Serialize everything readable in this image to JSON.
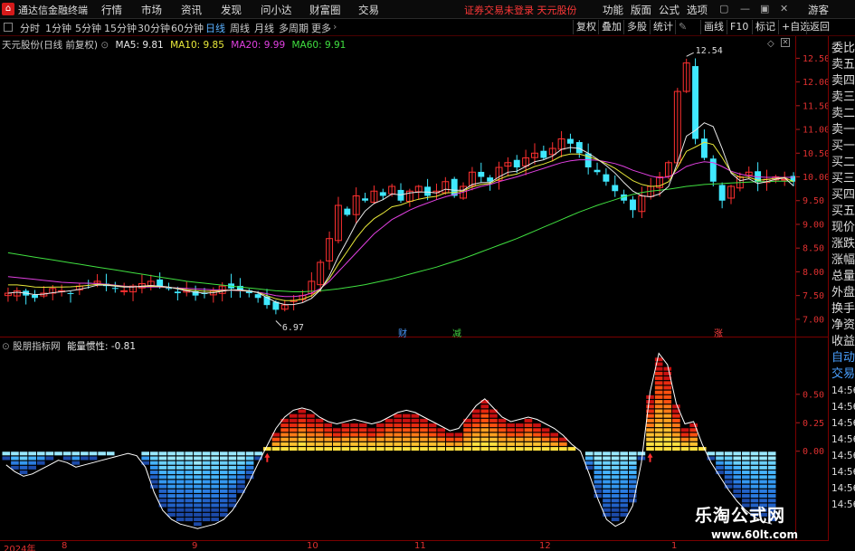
{
  "menubar": {
    "app_name": "通达信金融终端",
    "menus": [
      "行情",
      "市场",
      "资讯",
      "发现",
      "问小达",
      "财富圈",
      "交易"
    ],
    "warning": "证券交易未登录  天元股份",
    "right_menus": [
      "功能",
      "版面",
      "公式",
      "选项"
    ],
    "user": "游客"
  },
  "periodbar": {
    "periods": [
      "分时",
      "1分钟",
      "5分钟",
      "15分钟",
      "30分钟",
      "60分钟",
      "日线",
      "周线",
      "月线",
      "多周期",
      "更多"
    ],
    "active": "日线",
    "right_buttons": [
      "复权",
      "叠加",
      "多股",
      "统计",
      "画线",
      "F10",
      "标记",
      "+自选",
      "返回"
    ]
  },
  "legend": {
    "title": "天元股份(日线 前复权)",
    "ma": [
      {
        "label": "MA5: 9.81",
        "color": "#e8e8e8"
      },
      {
        "label": "MA10: 9.85",
        "color": "#e8e83a"
      },
      {
        "label": "MA20: 9.99",
        "color": "#e040e0"
      },
      {
        "label": "MA60: 9.91",
        "color": "#40e040"
      }
    ]
  },
  "indicator_legend": {
    "name": "股朋指标网",
    "series": "能量惯性: -0.81"
  },
  "price_axis": {
    "labels": [
      "12.50",
      "12.00",
      "11.50",
      "11.00",
      "10.50",
      "10.00",
      "9.50",
      "9.00",
      "8.50",
      "8.00",
      "7.50",
      "7.00"
    ],
    "min": 6.75,
    "max": 12.85
  },
  "indicator_axis": {
    "labels": [
      "0.50",
      "0.25",
      "0.00"
    ],
    "min": -0.75,
    "max": 0.92
  },
  "annotations": {
    "high": "12.54",
    "low": "6.97",
    "markers": [
      {
        "text": "财",
        "color": "#4a9aff"
      },
      {
        "text": "减",
        "color": "#40d040"
      },
      {
        "text": "涨",
        "color": "#ff4040"
      }
    ]
  },
  "sidepanel": {
    "items": [
      "委比",
      "卖五",
      "卖四",
      "卖三",
      "卖二",
      "卖一",
      "买一",
      "买二",
      "买三",
      "买四",
      "买五",
      "现价",
      "涨跌",
      "涨幅",
      "总量",
      "外盘",
      "换手",
      "净资",
      "收益",
      "自动",
      "交易",
      "14:56",
      "14:56",
      "14:56",
      "14:56",
      "14:56",
      "14:56",
      "14:56",
      "14:56"
    ],
    "blue_items": [
      "自动",
      "交易"
    ]
  },
  "dateaxis": {
    "labels": [
      "2024年",
      "8",
      "9",
      "10",
      "11",
      "12",
      "1"
    ]
  },
  "watermark": {
    "line1": "乐淘公式网",
    "line2": "www.60lt.com"
  },
  "chart_data": [
    {
      "type": "candlestick",
      "title": "天元股份(日线 前复权)",
      "ylim": [
        6.75,
        12.85
      ],
      "series_names": [
        "MA5",
        "MA10",
        "MA20",
        "MA60"
      ],
      "annotations": {
        "high": 12.54,
        "low": 6.97
      },
      "close_path": [
        7.55,
        7.6,
        7.5,
        7.45,
        7.55,
        7.65,
        7.6,
        7.55,
        7.7,
        7.75,
        7.8,
        7.7,
        7.65,
        7.6,
        7.7,
        7.75,
        7.8,
        7.7,
        7.65,
        7.55,
        7.6,
        7.5,
        7.55,
        7.6,
        7.7,
        7.65,
        7.6,
        7.55,
        7.45,
        7.3,
        7.2,
        7.3,
        7.4,
        7.5,
        7.8,
        8.2,
        8.7,
        9.4,
        9.2,
        9.6,
        9.5,
        9.7,
        9.6,
        9.8,
        9.5,
        9.7,
        9.8,
        9.6,
        9.7,
        9.9,
        9.6,
        9.8,
        10.1,
        10.0,
        9.9,
        10.2,
        10.3,
        10.2,
        10.4,
        10.5,
        10.4,
        10.6,
        10.8,
        10.7,
        10.5,
        10.2,
        10.1,
        9.9,
        9.7,
        9.5,
        9.3,
        9.6,
        9.8,
        10.0,
        10.3,
        11.8,
        12.4,
        10.8,
        10.4,
        9.9,
        9.5,
        9.8,
        10.0,
        10.1,
        9.9,
        9.95,
        10.0,
        9.95,
        9.9
      ],
      "ma5": [
        7.55,
        7.57,
        7.55,
        7.52,
        7.53,
        7.56,
        7.58,
        7.6,
        7.63,
        7.67,
        7.72,
        7.72,
        7.7,
        7.68,
        7.68,
        7.7,
        7.71,
        7.7,
        7.68,
        7.64,
        7.6,
        7.57,
        7.55,
        7.56,
        7.59,
        7.62,
        7.62,
        7.6,
        7.56,
        7.46,
        7.36,
        7.31,
        7.31,
        7.35,
        7.44,
        7.62,
        7.92,
        8.32,
        8.66,
        9.02,
        9.28,
        9.44,
        9.52,
        9.64,
        9.62,
        9.66,
        9.68,
        9.68,
        9.66,
        9.74,
        9.72,
        9.72,
        9.84,
        9.88,
        9.88,
        10.0,
        10.1,
        10.12,
        10.22,
        10.32,
        10.36,
        10.44,
        10.58,
        10.62,
        10.6,
        10.5,
        10.38,
        10.24,
        10.08,
        9.88,
        9.7,
        9.6,
        9.58,
        9.64,
        9.8,
        10.3,
        10.86,
        10.98,
        11.14,
        11.06,
        10.6,
        10.08,
        9.92,
        9.96,
        9.86,
        9.9,
        9.95,
        9.98,
        9.81
      ],
      "ma20": [
        7.9,
        7.88,
        7.86,
        7.84,
        7.82,
        7.8,
        7.78,
        7.77,
        7.76,
        7.76,
        7.75,
        7.74,
        7.72,
        7.7,
        7.69,
        7.68,
        7.68,
        7.68,
        7.67,
        7.66,
        7.65,
        7.64,
        7.63,
        7.62,
        7.62,
        7.61,
        7.6,
        7.59,
        7.57,
        7.54,
        7.5,
        7.48,
        7.48,
        7.5,
        7.55,
        7.65,
        7.8,
        8.0,
        8.2,
        8.4,
        8.6,
        8.8,
        8.95,
        9.1,
        9.2,
        9.3,
        9.38,
        9.45,
        9.52,
        9.58,
        9.63,
        9.68,
        9.74,
        9.8,
        9.84,
        9.9,
        9.95,
        10.0,
        10.06,
        10.12,
        10.18,
        10.24,
        10.3,
        10.34,
        10.36,
        10.36,
        10.35,
        10.32,
        10.28,
        10.22,
        10.14,
        10.08,
        10.02,
        9.98,
        10.0,
        10.1,
        10.22,
        10.28,
        10.32,
        10.3,
        10.22,
        10.12,
        10.06,
        10.02,
        10.0,
        9.99,
        9.99,
        9.99,
        9.99
      ],
      "ma60": [
        8.4,
        8.37,
        8.34,
        8.31,
        8.28,
        8.25,
        8.22,
        8.19,
        8.16,
        8.13,
        8.1,
        8.07,
        8.04,
        8.01,
        7.98,
        7.95,
        7.92,
        7.89,
        7.86,
        7.83,
        7.8,
        7.78,
        7.76,
        7.74,
        7.72,
        7.7,
        7.68,
        7.66,
        7.64,
        7.62,
        7.6,
        7.59,
        7.58,
        7.58,
        7.59,
        7.6,
        7.62,
        7.64,
        7.67,
        7.7,
        7.73,
        7.77,
        7.81,
        7.85,
        7.9,
        7.95,
        8.0,
        8.05,
        8.1,
        8.16,
        8.22,
        8.28,
        8.35,
        8.42,
        8.49,
        8.56,
        8.63,
        8.7,
        8.78,
        8.86,
        8.94,
        9.02,
        9.1,
        9.18,
        9.26,
        9.33,
        9.4,
        9.46,
        9.52,
        9.58,
        9.63,
        9.67,
        9.7,
        9.72,
        9.74,
        9.77,
        9.8,
        9.82,
        9.84,
        9.85,
        9.86,
        9.87,
        9.88,
        9.89,
        9.9,
        9.9,
        9.91,
        9.91,
        9.91
      ]
    },
    {
      "type": "area",
      "title": "股朋指标网",
      "series_names": [
        "能量惯性"
      ],
      "ylim": [
        -0.75,
        0.92
      ],
      "values": [
        -0.12,
        -0.18,
        -0.22,
        -0.2,
        -0.16,
        -0.12,
        -0.08,
        -0.1,
        -0.14,
        -0.12,
        -0.1,
        -0.08,
        -0.06,
        -0.04,
        -0.02,
        -0.04,
        -0.14,
        -0.36,
        -0.52,
        -0.6,
        -0.64,
        -0.66,
        -0.68,
        -0.66,
        -0.64,
        -0.6,
        -0.52,
        -0.4,
        -0.26,
        -0.1,
        0.05,
        0.2,
        0.3,
        0.36,
        0.38,
        0.36,
        0.3,
        0.26,
        0.24,
        0.26,
        0.28,
        0.26,
        0.24,
        0.26,
        0.3,
        0.34,
        0.36,
        0.34,
        0.3,
        0.26,
        0.22,
        0.18,
        0.2,
        0.3,
        0.4,
        0.46,
        0.38,
        0.3,
        0.26,
        0.28,
        0.3,
        0.28,
        0.24,
        0.2,
        0.14,
        0.06,
        0.0,
        -0.2,
        -0.42,
        -0.6,
        -0.66,
        -0.62,
        -0.48,
        -0.1,
        0.52,
        0.86,
        0.76,
        0.42,
        0.24,
        0.26,
        0.06,
        -0.1,
        -0.22,
        -0.34,
        -0.44,
        -0.52,
        -0.58,
        -0.62,
        -0.64
      ]
    }
  ]
}
